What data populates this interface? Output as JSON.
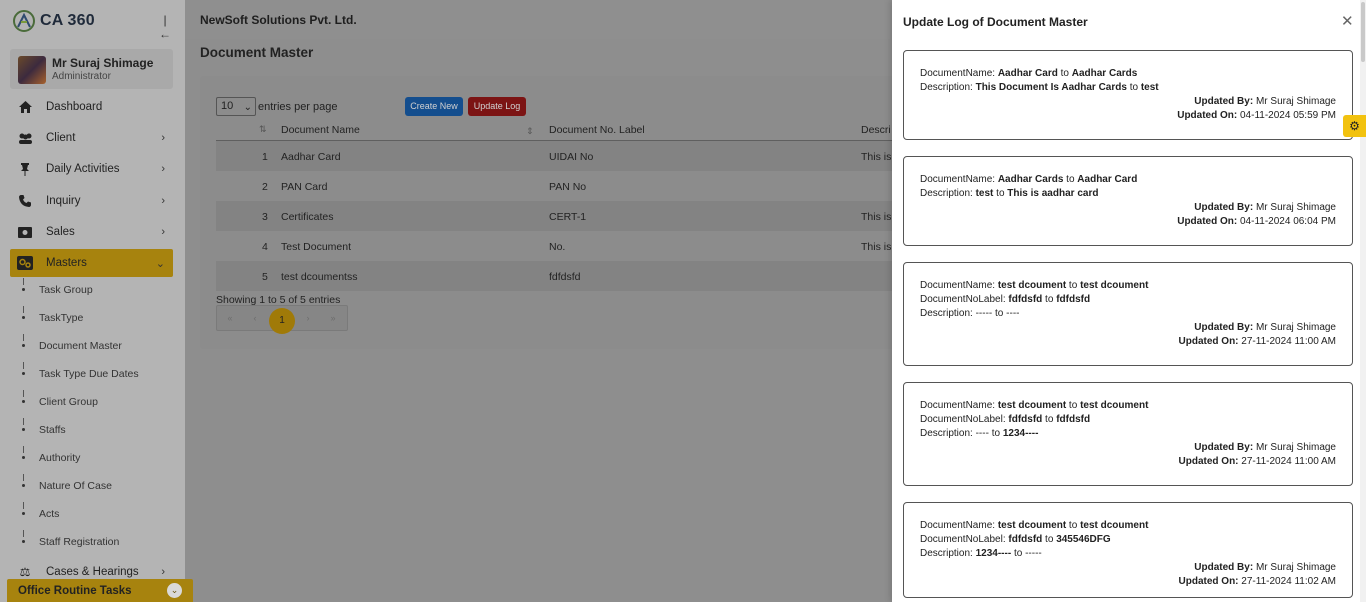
{
  "app": {
    "logo_text": "CA 360"
  },
  "sidebar": {
    "user": {
      "name": "Mr Suraj Shimage",
      "role": "Administrator"
    },
    "items": [
      {
        "label": "Dashboard",
        "icon": "home-icon"
      },
      {
        "label": "Client",
        "icon": "users-icon"
      },
      {
        "label": "Daily Activities",
        "icon": "pin-icon"
      },
      {
        "label": "Inquiry",
        "icon": "phone-icon"
      },
      {
        "label": "Sales",
        "icon": "sales-icon"
      },
      {
        "label": "Masters",
        "icon": "masters-icon"
      }
    ],
    "sub_items": [
      "Task Group",
      "TaskType",
      "Document Master",
      "Task Type Due Dates",
      "Client Group",
      "Staffs",
      "Authority",
      "Nature Of Case",
      "Acts",
      "Staff Registration"
    ],
    "cases_label": "Cases & Hearings",
    "office_tasks_label": "Office Routine Tasks"
  },
  "topbar": {
    "company": "NewSoft Solutions Pvt. Ltd."
  },
  "main": {
    "page_title": "Document Master",
    "entries_value": "10",
    "entries_label": "entries per page",
    "create_label": "Create New",
    "update_log_label": "Update Log",
    "columns": [
      "Document Name",
      "Document No. Label",
      "Descri"
    ],
    "rows": [
      {
        "no": "1",
        "name": "Aadhar Card",
        "label": "UIDAI No",
        "desc": "This is"
      },
      {
        "no": "2",
        "name": "PAN Card",
        "label": "PAN No",
        "desc": ""
      },
      {
        "no": "3",
        "name": "Certificates",
        "label": "CERT-1",
        "desc": "This is"
      },
      {
        "no": "4",
        "name": "Test Document",
        "label": "No.",
        "desc": "This is"
      },
      {
        "no": "5",
        "name": "test dcoumentss",
        "label": "fdfdsfd",
        "desc": ""
      }
    ],
    "showing": "Showing 1 to 5 of 5 entries",
    "pager": {
      "first": "«",
      "prev": "‹",
      "current": "1",
      "next": "›",
      "last": "»"
    }
  },
  "panel": {
    "title": "Update Log of Document Master",
    "updated_by_label": "Updated By:",
    "updated_on_label": "Updated On:",
    "logs": [
      {
        "lines": [
          {
            "label": "DocumentName:",
            "from": "Aadhar Card",
            "to": "Aadhar Cards"
          },
          {
            "label": "Description:",
            "from": "This Document Is Aadhar Cards",
            "to": "test"
          }
        ],
        "by": "Mr Suraj Shimage",
        "on": "04-11-2024 05:59 PM"
      },
      {
        "lines": [
          {
            "label": "DocumentName:",
            "from": "Aadhar Cards",
            "to": "Aadhar Card"
          },
          {
            "label": "Description:",
            "from": "test",
            "to": "This is aadhar card"
          }
        ],
        "by": "Mr Suraj Shimage",
        "on": "04-11-2024 06:04 PM"
      },
      {
        "lines": [
          {
            "label": "DocumentName:",
            "from": "test dcoument",
            "to": "test dcoument"
          },
          {
            "label": "DocumentNoLabel:",
            "from": "fdfdsfd",
            "to": "fdfdsfd"
          },
          {
            "label": "Description:",
            "from": "-----",
            "to": "----"
          }
        ],
        "by": "Mr Suraj Shimage",
        "on": "27-11-2024 11:00 AM"
      },
      {
        "lines": [
          {
            "label": "DocumentName:",
            "from": "test dcoument",
            "to": "test dcoument"
          },
          {
            "label": "DocumentNoLabel:",
            "from": "fdfdsfd",
            "to": "fdfdsfd"
          },
          {
            "label": "Description:",
            "from": "----",
            "to": "1234----"
          }
        ],
        "by": "Mr Suraj Shimage",
        "on": "27-11-2024 11:00 AM"
      },
      {
        "lines": [
          {
            "label": "DocumentName:",
            "from": "test dcoument",
            "to": "test dcoument"
          },
          {
            "label": "DocumentNoLabel:",
            "from": "fdfdsfd",
            "to": "345546DFG"
          },
          {
            "label": "Description:",
            "from": "1234----",
            "to": "-----"
          }
        ],
        "by": "Mr Suraj Shimage",
        "on": "27-11-2024 11:02 AM"
      }
    ]
  }
}
